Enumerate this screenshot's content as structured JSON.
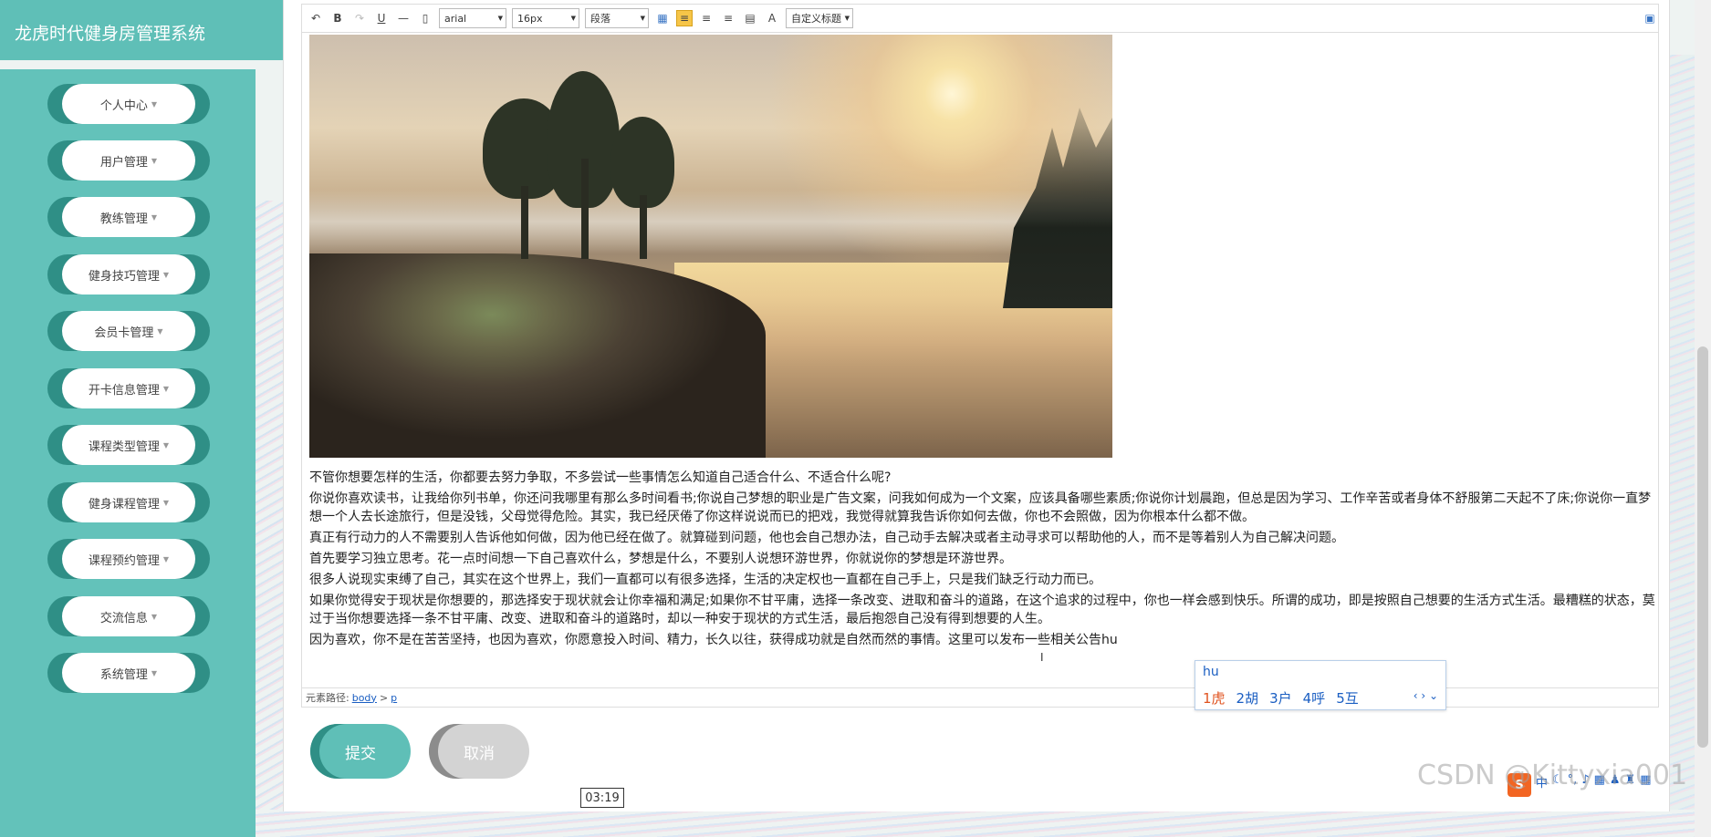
{
  "app": {
    "title": "龙虎时代健身房管理系统"
  },
  "sidebar": {
    "items": [
      {
        "label": "个人中心"
      },
      {
        "label": "用户管理"
      },
      {
        "label": "教练管理"
      },
      {
        "label": "健身技巧管理"
      },
      {
        "label": "会员卡管理"
      },
      {
        "label": "开卡信息管理"
      },
      {
        "label": "课程类型管理"
      },
      {
        "label": "健身课程管理"
      },
      {
        "label": "课程预约管理"
      },
      {
        "label": "交流信息"
      },
      {
        "label": "系统管理"
      }
    ]
  },
  "toolbar": {
    "font_family": "arial",
    "font_size": "16px",
    "paragraph": "段落",
    "custom_title": "自定义标题",
    "text_color_label": "A"
  },
  "editor": {
    "paragraphs": [
      "不管你想要怎样的生活，你都要去努力争取，不多尝试一些事情怎么知道自己适合什么、不适合什么呢?",
      "你说你喜欢读书，让我给你列书单，你还问我哪里有那么多时间看书;你说自己梦想的职业是广告文案，问我如何成为一个文案，应该具备哪些素质;你说你计划晨跑，但总是因为学习、工作辛苦或者身体不舒服第二天起不了床;你说你一直梦想一个人去长途旅行，但是没钱，父母觉得危险。其实，我已经厌倦了你这样说说而已的把戏，我觉得就算我告诉你如何去做，你也不会照做，因为你根本什么都不做。",
      "真正有行动力的人不需要别人告诉他如何做，因为他已经在做了。就算碰到问题，他也会自己想办法，自己动手去解决或者主动寻求可以帮助他的人，而不是等着别人为自己解决问题。",
      "首先要学习独立思考。花一点时间想一下自己喜欢什么，梦想是什么，不要别人说想环游世界，你就说你的梦想是环游世界。",
      "很多人说现实束缚了自己，其实在这个世界上，我们一直都可以有很多选择，生活的决定权也一直都在自己手上，只是我们缺乏行动力而已。",
      "如果你觉得安于现状是你想要的，那选择安于现状就会让你幸福和满足;如果你不甘平庸，选择一条改变、进取和奋斗的道路，在这个追求的过程中，你也一样会感到快乐。所谓的成功，即是按照自己想要的生活方式生活。最糟糕的状态，莫过于当你想要选择一条不甘平庸、改变、进取和奋斗的道路时，却以一种安于现状的方式生活，最后抱怨自己没有得到想要的人生。",
      "因为喜欢，你不是在苦苦坚持，也因为喜欢，你愿意投入时间、精力，长久以往，获得成功就是自然而然的事情。这里可以发布一些相关公告hu"
    ]
  },
  "status_bar": {
    "label": "元素路径:",
    "body": "body",
    "sep": ">",
    "p": "p"
  },
  "ime": {
    "input": "hu",
    "candidates": [
      "1虎",
      "2胡",
      "3户",
      "4呼",
      "5互"
    ],
    "nav": "‹ › ⌄"
  },
  "buttons": {
    "submit": "提交",
    "cancel": "取消"
  },
  "video_time": "03:19",
  "tray": {
    "logo": "S",
    "lang": "中"
  },
  "watermark": "CSDN @Kittyxia001"
}
